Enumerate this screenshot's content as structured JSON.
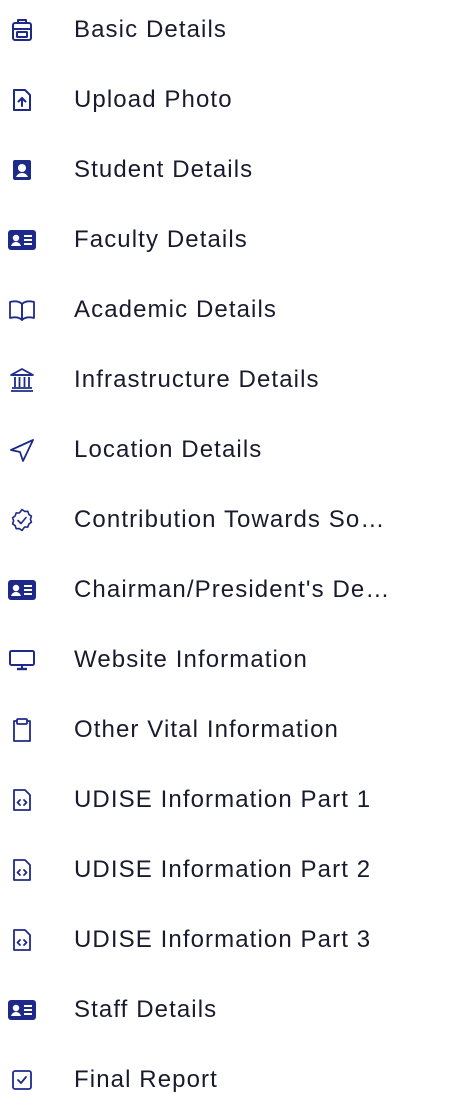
{
  "menu": {
    "items": [
      {
        "label": "Basic Details",
        "icon": "briefcase-icon"
      },
      {
        "label": "Upload Photo",
        "icon": "upload-file-icon"
      },
      {
        "label": "Student Details",
        "icon": "student-portrait-icon"
      },
      {
        "label": "Faculty Details",
        "icon": "id-card-icon"
      },
      {
        "label": "Academic Details",
        "icon": "open-book-icon"
      },
      {
        "label": "Infrastructure Details",
        "icon": "building-icon"
      },
      {
        "label": "Location Details",
        "icon": "navigation-arrow-icon"
      },
      {
        "label": "Contribution Towards Society",
        "icon": "badge-check-icon"
      },
      {
        "label": "Chairman/President's Details",
        "icon": "id-card-icon"
      },
      {
        "label": "Website Information",
        "icon": "monitor-icon"
      },
      {
        "label": "Other Vital Information",
        "icon": "clipboard-icon"
      },
      {
        "label": "UDISE Information Part 1",
        "icon": "code-file-icon"
      },
      {
        "label": "UDISE Information Part 2",
        "icon": "code-file-icon"
      },
      {
        "label": "UDISE Information Part 3",
        "icon": "code-file-icon"
      },
      {
        "label": "Staff Details",
        "icon": "id-card-icon"
      },
      {
        "label": "Final Report",
        "icon": "checkbox-icon"
      }
    ]
  },
  "colors": {
    "icon": "#1e2a8a",
    "text": "#1a1a2e",
    "background": "#ffffff"
  }
}
